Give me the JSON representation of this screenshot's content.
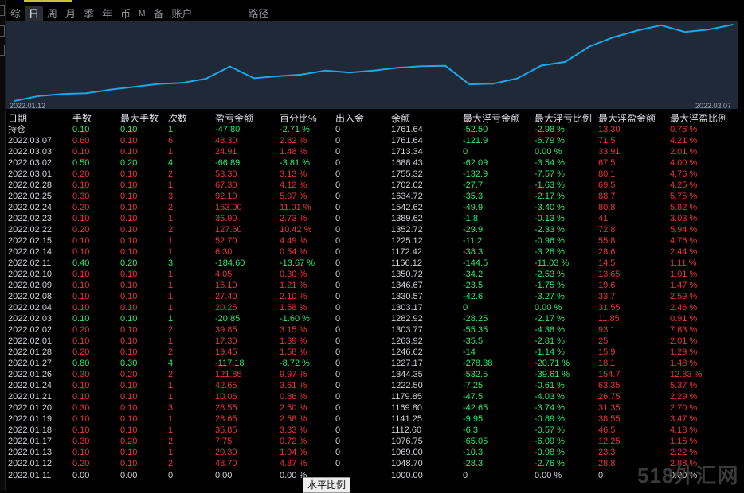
{
  "tabs": [
    {
      "label": "综",
      "active": false
    },
    {
      "label": "日",
      "active": true
    },
    {
      "label": "周",
      "active": false
    },
    {
      "label": "月",
      "active": false
    },
    {
      "label": "季",
      "active": false
    },
    {
      "label": "年",
      "active": false
    },
    {
      "label": "币",
      "active": false
    },
    {
      "label": "M",
      "active": false
    },
    {
      "label": "备",
      "active": false
    },
    {
      "label": "账户",
      "active": false
    },
    {
      "label": "路径",
      "active": false
    }
  ],
  "chart_data": {
    "type": "line",
    "x_start_label": "2022.01.12",
    "x_end_label": "2022.03.07",
    "series": [
      {
        "values": [
          1000.0,
          1048.7,
          1069.0,
          1076.75,
          1112.6,
          1141.25,
          1169.8,
          1179.85,
          1222.5,
          1344.35,
          1227.17,
          1246.62,
          1263.92,
          1303.77,
          1282.92,
          1303.17,
          1330.57,
          1346.67,
          1350.72,
          1166.12,
          1172.42,
          1225.12,
          1352.72,
          1389.62,
          1542.62,
          1634.72,
          1702.02,
          1755.32,
          1688.43,
          1713.34,
          1761.64
        ]
      }
    ],
    "color": "#1ba8ea"
  },
  "table": {
    "headers": [
      "日期",
      "手数",
      "最大手数",
      "次数",
      "盈亏金额",
      "百分比%",
      "出入金",
      "余额",
      "最大浮亏金额",
      "最大浮亏比例",
      "最大浮盈金额",
      "最大浮盈比例"
    ],
    "rows": [
      {
        "c": [
          "持仓",
          "0.10",
          "0.10",
          "1",
          "-47.80",
          "-2.71 %",
          "0",
          "1761.64",
          "-52.50",
          "-2.98 %",
          "13.30",
          "0.76 %"
        ],
        "s": "g"
      },
      {
        "c": [
          "2022.03.07",
          "0.60",
          "0.10",
          "6",
          "48.30",
          "2.82 %",
          "0",
          "1761.64",
          "-121.9",
          "-6.79 %",
          "71.5",
          "4.21 %"
        ],
        "s": "r"
      },
      {
        "c": [
          "2022.03.03",
          "0.10",
          "0.10",
          "1",
          "24.91",
          "1.48 %",
          "0",
          "1713.34",
          "0",
          "0.00 %",
          "33.91",
          "2.01 %"
        ],
        "s": "r"
      },
      {
        "c": [
          "2022.03.02",
          "0.50",
          "0.20",
          "4",
          "-66.89",
          "-3.81 %",
          "0",
          "1688.43",
          "-62.09",
          "-3.54 %",
          "67.5",
          "4.00 %"
        ],
        "s": "g"
      },
      {
        "c": [
          "2022.03.01",
          "0.20",
          "0.10",
          "2",
          "53.30",
          "3.13 %",
          "0",
          "1755.32",
          "-132.9",
          "-7.57 %",
          "80.1",
          "4.76 %"
        ],
        "s": "r"
      },
      {
        "c": [
          "2022.02.28",
          "0.10",
          "0.10",
          "1",
          "67.30",
          "4.12 %",
          "0",
          "1702.02",
          "-27.7",
          "-1.63 %",
          "69.5",
          "4.25 %"
        ],
        "s": "r"
      },
      {
        "c": [
          "2022.02.25",
          "0.30",
          "0.10",
          "3",
          "92.10",
          "5.97 %",
          "0",
          "1634.72",
          "-35.3",
          "-2.17 %",
          "88.7",
          "5.75 %"
        ],
        "s": "r"
      },
      {
        "c": [
          "2022.02.24",
          "0.20",
          "0.10",
          "2",
          "153.00",
          "11.01 %",
          "0",
          "1542.62",
          "-49.9",
          "-3.40 %",
          "80.8",
          "5.82 %"
        ],
        "s": "r"
      },
      {
        "c": [
          "2022.02.23",
          "0.10",
          "0.10",
          "1",
          "36.90",
          "2.73 %",
          "0",
          "1389.62",
          "-1.8",
          "-0.13 %",
          "41",
          "3.03 %"
        ],
        "s": "r"
      },
      {
        "c": [
          "2022.02.22",
          "0.20",
          "0.10",
          "2",
          "127.60",
          "10.42 %",
          "0",
          "1352.72",
          "-29.9",
          "-2.33 %",
          "72.8",
          "5.94 %"
        ],
        "s": "r"
      },
      {
        "c": [
          "2022.02.15",
          "0.10",
          "0.10",
          "1",
          "52.70",
          "4.49 %",
          "0",
          "1225.12",
          "-11.2",
          "-0.96 %",
          "55.8",
          "4.76 %"
        ],
        "s": "r"
      },
      {
        "c": [
          "2022.02.14",
          "0.10",
          "0.10",
          "1",
          "6.30",
          "0.54 %",
          "0",
          "1172.42",
          "-38.3",
          "-3.28 %",
          "28.6",
          "2.44 %"
        ],
        "s": "r"
      },
      {
        "c": [
          "2022.02.11",
          "0.40",
          "0.20",
          "3",
          "-184.60",
          "-13.67 %",
          "0",
          "1166.12",
          "-144.5",
          "-11.03 %",
          "14.5",
          "1.11 %"
        ],
        "s": "g"
      },
      {
        "c": [
          "2022.02.10",
          "0.10",
          "0.10",
          "1",
          "4.05",
          "0.30 %",
          "0",
          "1350.72",
          "-34.2",
          "-2.53 %",
          "13.65",
          "1.01 %"
        ],
        "s": "r"
      },
      {
        "c": [
          "2022.02.09",
          "0.10",
          "0.10",
          "1",
          "16.10",
          "1.21 %",
          "0",
          "1346.67",
          "-23.5",
          "-1.75 %",
          "19.6",
          "1.47 %"
        ],
        "s": "r"
      },
      {
        "c": [
          "2022.02.08",
          "0.10",
          "0.10",
          "1",
          "27.40",
          "2.10 %",
          "0",
          "1330.57",
          "-42.6",
          "-3.27 %",
          "33.7",
          "2.59 %"
        ],
        "s": "r"
      },
      {
        "c": [
          "2022.02.04",
          "0.10",
          "0.10",
          "1",
          "20.25",
          "1.58 %",
          "0",
          "1303.17",
          "0",
          "0.00 %",
          "31.55",
          "2.46 %"
        ],
        "s": "r"
      },
      {
        "c": [
          "2022.02.03",
          "0.10",
          "0.10",
          "1",
          "-20.85",
          "-1.60 %",
          "0",
          "1282.92",
          "-28.25",
          "-2.17 %",
          "11.85",
          "0.91 %"
        ],
        "s": "g"
      },
      {
        "c": [
          "2022.02.02",
          "0.20",
          "0.10",
          "2",
          "39.85",
          "3.15 %",
          "0",
          "1303.77",
          "-55.35",
          "-4.38 %",
          "93.1",
          "7.63 %"
        ],
        "s": "r"
      },
      {
        "c": [
          "2022.02.01",
          "0.10",
          "0.10",
          "1",
          "17.30",
          "1.39 %",
          "0",
          "1263.92",
          "-35.5",
          "-2.81 %",
          "25",
          "2.01 %"
        ],
        "s": "r"
      },
      {
        "c": [
          "2022.01.28",
          "0.20",
          "0.10",
          "2",
          "19.45",
          "1.58 %",
          "0",
          "1246.62",
          "-14",
          "-1.14 %",
          "15.9",
          "1.29 %"
        ],
        "s": "r"
      },
      {
        "c": [
          "2022.01.27",
          "0.80",
          "0.30",
          "4",
          "-117.18",
          "-8.72 %",
          "0",
          "1227.17",
          "-278.38",
          "-20.71 %",
          "18.1",
          "1.48 %"
        ],
        "s": "g"
      },
      {
        "c": [
          "2022.01.26",
          "0.30",
          "0.20",
          "2",
          "121.85",
          "9.97 %",
          "0",
          "1344.35",
          "-532.5",
          "-39.61 %",
          "154.7",
          "12.83 %"
        ],
        "s": "r"
      },
      {
        "c": [
          "2022.01.24",
          "0.10",
          "0.10",
          "1",
          "42.65",
          "3.61 %",
          "0",
          "1222.50",
          "-7.25",
          "-0.61 %",
          "63.35",
          "5.37 %"
        ],
        "s": "r"
      },
      {
        "c": [
          "2022.01.21",
          "0.10",
          "0.10",
          "1",
          "10.05",
          "0.86 %",
          "0",
          "1179.85",
          "-47.5",
          "-4.03 %",
          "26.75",
          "2.29 %"
        ],
        "s": "r"
      },
      {
        "c": [
          "2022.01.20",
          "0.30",
          "0.10",
          "3",
          "28.55",
          "2.50 %",
          "0",
          "1169.80",
          "-42.65",
          "-3.74 %",
          "31.35",
          "2.70 %"
        ],
        "s": "r"
      },
      {
        "c": [
          "2022.01.19",
          "0.10",
          "0.10",
          "1",
          "28.65",
          "2.58 %",
          "0",
          "1141.25",
          "-9.95",
          "-0.89 %",
          "38.55",
          "3.47 %"
        ],
        "s": "r"
      },
      {
        "c": [
          "2022.01.18",
          "0.10",
          "0.10",
          "1",
          "35.85",
          "3.33 %",
          "0",
          "1112.60",
          "-6.3",
          "-0.57 %",
          "46.5",
          "4.18 %"
        ],
        "s": "r"
      },
      {
        "c": [
          "2022.01.17",
          "0.30",
          "0.20",
          "2",
          "7.75",
          "0.72 %",
          "0",
          "1076.75",
          "-65.05",
          "-6.09 %",
          "12.25",
          "1.15 %"
        ],
        "s": "r"
      },
      {
        "c": [
          "2022.01.13",
          "0.10",
          "0.10",
          "1",
          "20.30",
          "1.94 %",
          "0",
          "1069.00",
          "-10.3",
          "-0.98 %",
          "23.3",
          "2.22 %"
        ],
        "s": "r"
      },
      {
        "c": [
          "2022.01.12",
          "0.20",
          "0.10",
          "2",
          "48.70",
          "4.87 %",
          "0",
          "1048.70",
          "-28.3",
          "-2.76 %",
          "28.8",
          "2.88 %"
        ],
        "s": "r"
      },
      {
        "c": [
          "2022.01.11",
          "0.00",
          "0.00",
          "0",
          "0.00",
          "0.00 %",
          "",
          "1000.00",
          "0",
          "0.00 %",
          "0",
          "0.00 %"
        ],
        "s": "n"
      }
    ]
  },
  "tooltip": "水平比例",
  "watermark": "518外汇网"
}
